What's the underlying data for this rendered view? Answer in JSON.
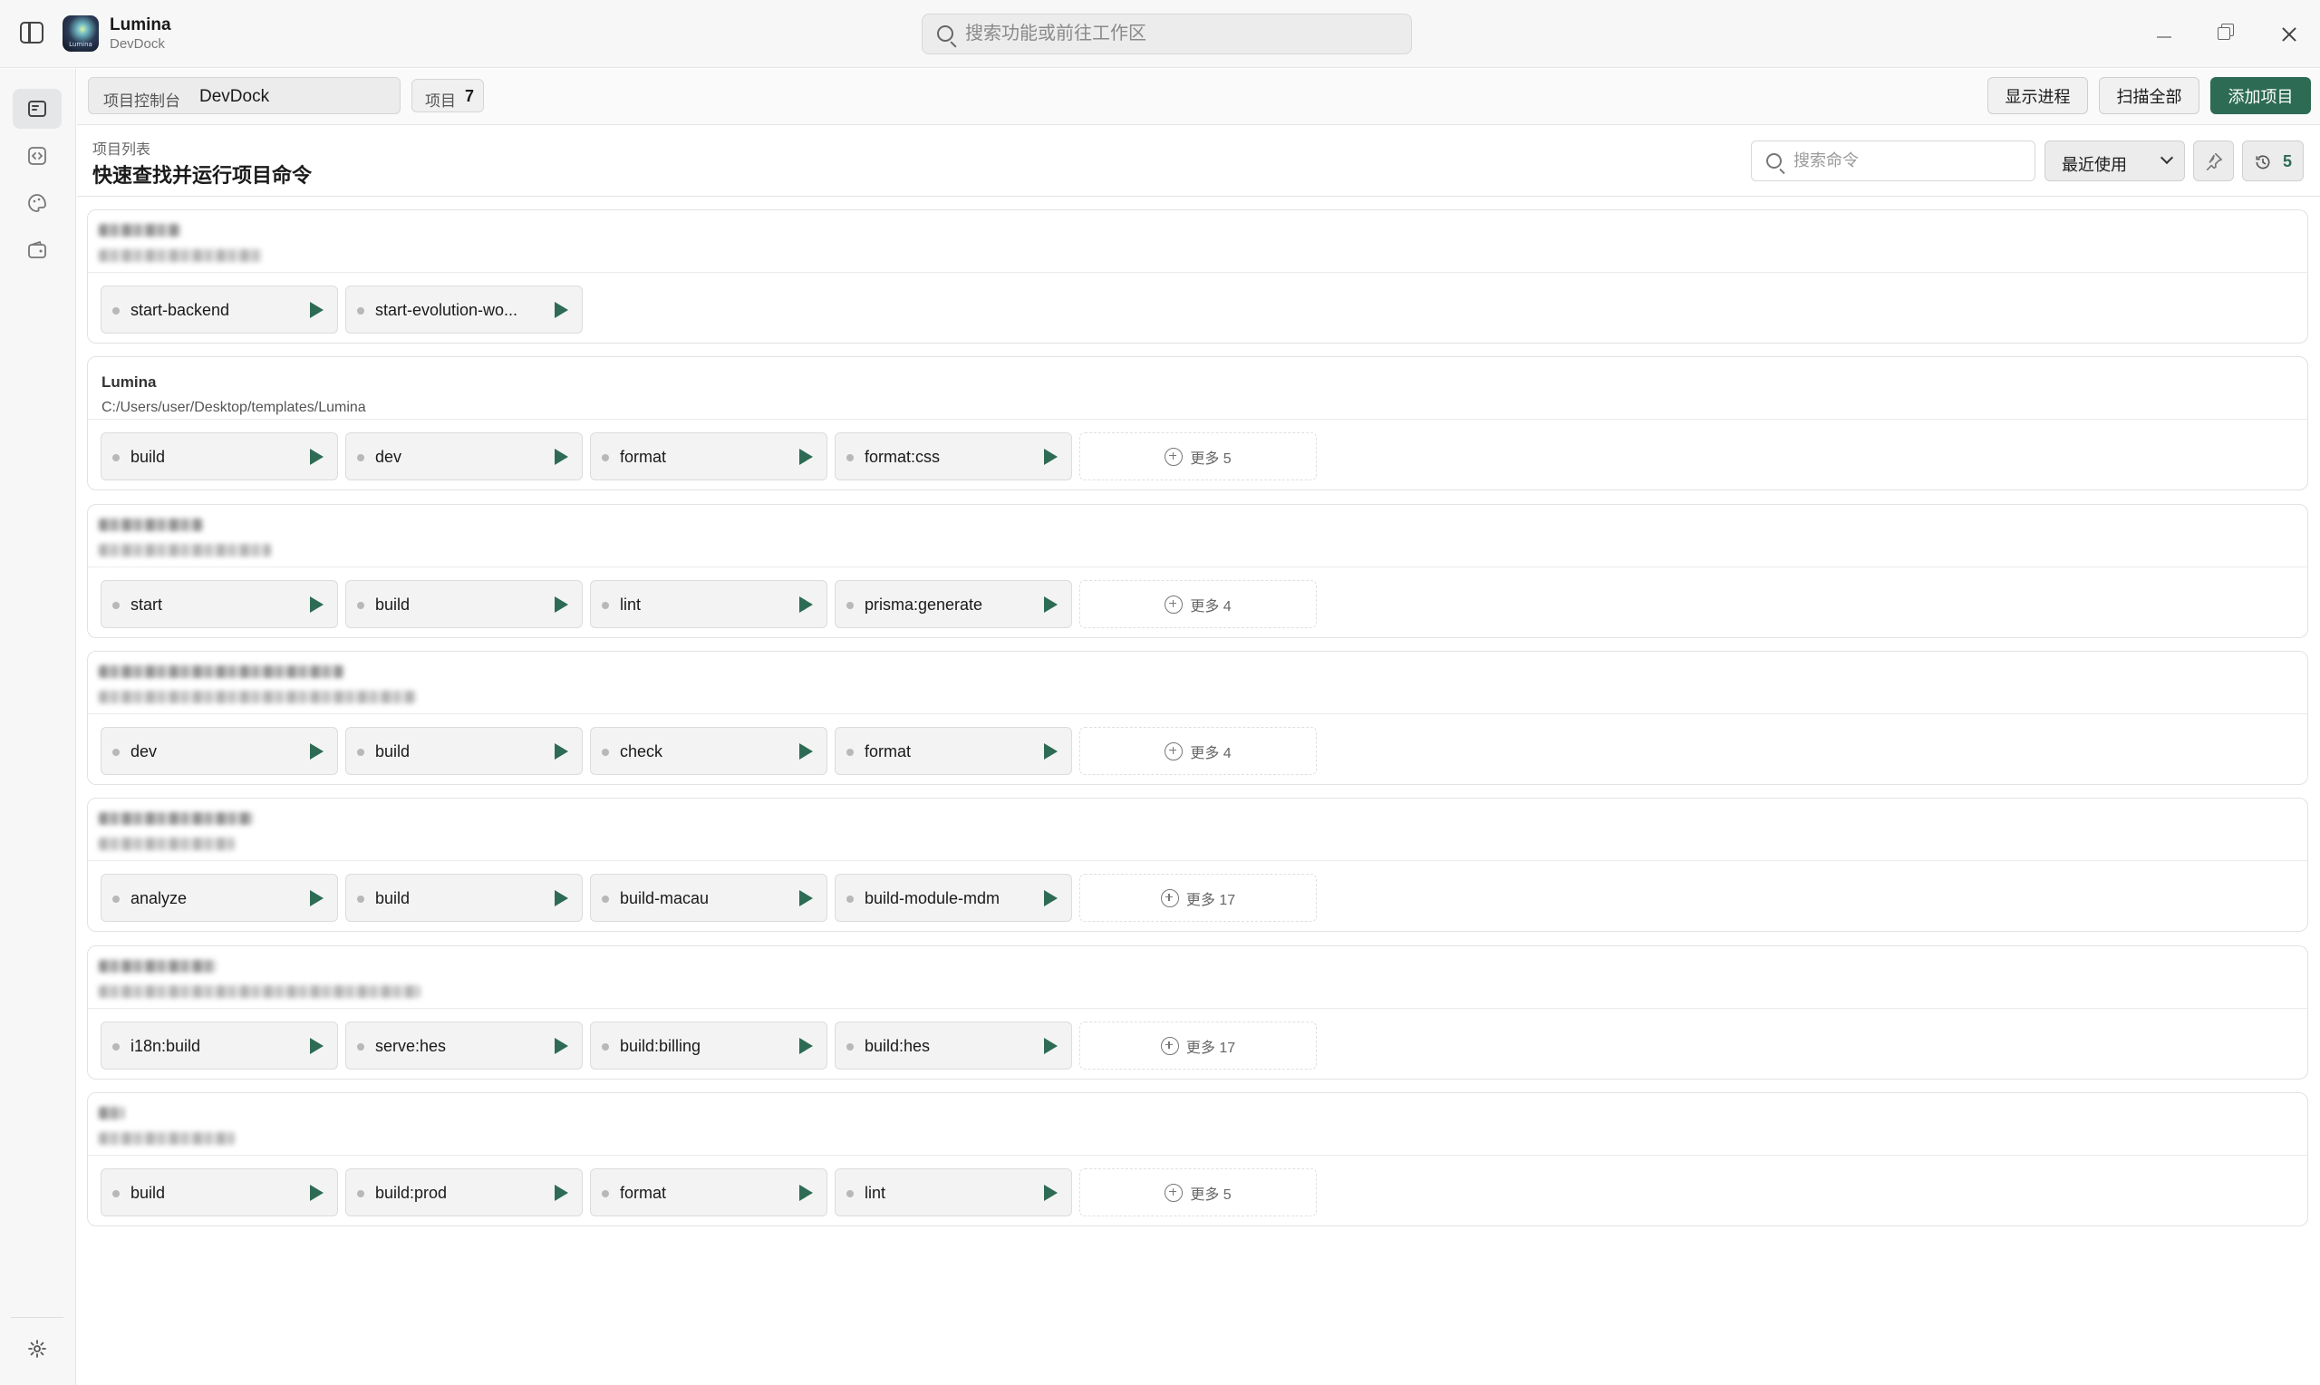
{
  "app": {
    "name": "Lumina",
    "subtitle": "DevDock",
    "logo_text": "Lumina"
  },
  "global_search": {
    "placeholder": "搜索功能或前往工作区"
  },
  "toolbar": {
    "console_label": "项目控制台",
    "console_value": "DevDock",
    "project_count_label": "项目",
    "project_count": "7",
    "show_process_label": "显示进程",
    "scan_all_label": "扫描全部",
    "add_project_label": "添加项目"
  },
  "header": {
    "caption": "项目列表",
    "title": "快速查找并运行项目命令",
    "search_placeholder": "搜索命令",
    "sort_value": "最近使用",
    "history_count": "5"
  },
  "rail": {
    "items": [
      "projects-icon",
      "code-icon",
      "palette-icon",
      "wallet-icon"
    ],
    "settings": "gear-icon"
  },
  "colors": {
    "accent": "#2e6b55",
    "background": "#ffffff",
    "sidebar": "#f7f7f7"
  },
  "projects": [
    {
      "name": "",
      "path": "",
      "commands": [
        "start-backend",
        "start-evolution-wo..."
      ],
      "more": ""
    },
    {
      "name": "Lumina",
      "path": "C:/Users/user/Desktop/templates/Lumina",
      "commands": [
        "build",
        "dev",
        "format",
        "format:css"
      ],
      "more": "更多 5"
    },
    {
      "name": "",
      "path": "",
      "commands": [
        "start",
        "build",
        "lint",
        "prisma:generate"
      ],
      "more": "更多 4"
    },
    {
      "name": "",
      "path": "",
      "commands": [
        "dev",
        "build",
        "check",
        "format"
      ],
      "more": "更多 4"
    },
    {
      "name": "",
      "path": "",
      "commands": [
        "analyze",
        "build",
        "build-macau",
        "build-module-mdm"
      ],
      "more": "更多 17"
    },
    {
      "name": "",
      "path": "",
      "commands": [
        "i18n:build",
        "serve:hes",
        "build:billing",
        "build:hes"
      ],
      "more": "更多 17"
    },
    {
      "name": "",
      "path": "",
      "commands": [
        "build",
        "build:prod",
        "format",
        "lint"
      ],
      "more": "更多 5"
    }
  ]
}
